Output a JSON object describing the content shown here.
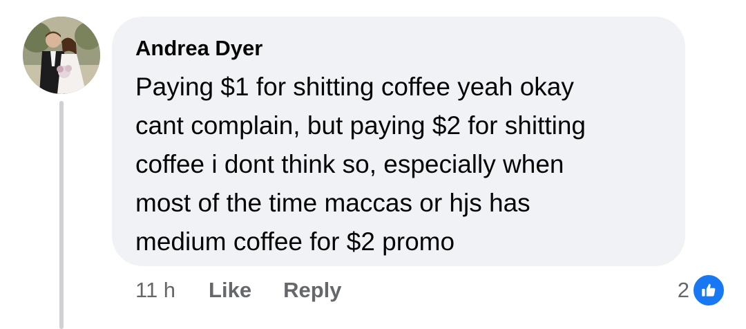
{
  "comment": {
    "author": "Andrea Dyer",
    "lines": [
      "Paying $1 for shitting coffee yeah okay",
      "cant complain, but paying $2 for shitting",
      "coffee i dont think so, especially when",
      "most of the time maccas or hjs has",
      "medium coffee for $2 promo"
    ],
    "timestamp": "11 h",
    "like_label": "Like",
    "reply_label": "Reply",
    "reaction_count": "2",
    "reaction_icon": "like-thumb-icon"
  },
  "colors": {
    "bubble": "#f0f2f5",
    "text": "#050505",
    "secondary": "#65676b",
    "like_blue": "#1877f2"
  }
}
